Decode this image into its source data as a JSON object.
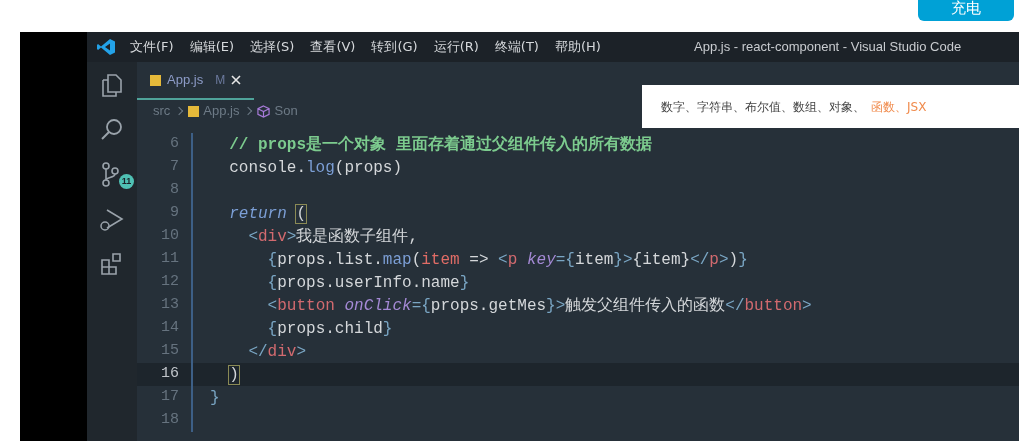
{
  "page_button": {
    "label": "充电"
  },
  "menu_bar": {
    "items": [
      "文件(F)",
      "编辑(E)",
      "选择(S)",
      "查看(V)",
      "转到(G)",
      "运行(R)",
      "终端(T)",
      "帮助(H)"
    ],
    "title": "App.js - react-component - Visual Studio Code"
  },
  "activity_bar": {
    "items": [
      {
        "kind": "files"
      },
      {
        "kind": "search"
      },
      {
        "kind": "source-control",
        "badge": "11"
      },
      {
        "kind": "debug"
      },
      {
        "kind": "extensions"
      }
    ]
  },
  "tabs": [
    {
      "label": "App.js",
      "status": "M",
      "selected": true
    }
  ],
  "breadcrumb": [
    "src",
    "App.js",
    "Son"
  ],
  "popup": {
    "text": "数字、字符串、布尔值、数组、对象、",
    "highlight": "函数、JSX"
  },
  "code": [
    {
      "number": "6",
      "current": false,
      "tokens": [
        {
          "text": "  // props是一个对象 里面存着通过父组件传入的所有数据",
          "kind": "comment"
        }
      ]
    },
    {
      "number": "7",
      "current": false,
      "tokens": [
        {
          "text": "  console.",
          "kind": "plain"
        },
        {
          "text": "log",
          "kind": "func"
        },
        {
          "text": "(props)",
          "kind": "plain"
        }
      ]
    },
    {
      "number": "8",
      "current": false
    },
    {
      "number": "9",
      "current": false,
      "tokens": [
        {
          "text": "  return",
          "kind": "keyword"
        },
        {
          "text": " (",
          "kind": "match"
        }
      ]
    },
    {
      "number": "10",
      "current": false,
      "tokens": [
        {
          "text": "    <",
          "kind": "punct"
        },
        {
          "text": "div",
          "kind": "tag"
        },
        {
          "text": ">",
          "kind": "punct"
        },
        {
          "text": "我是函数子组件,",
          "kind": "plain"
        }
      ]
    },
    {
      "number": "11",
      "current": false,
      "tokens": [
        {
          "text": "      {",
          "kind": "punct"
        },
        {
          "text": "props.list.",
          "kind": "plain"
        },
        {
          "text": "map",
          "kind": "func"
        },
        {
          "text": "(",
          "kind": "plain"
        },
        {
          "text": "item",
          "kind": "param"
        },
        {
          "text": " => ",
          "kind": "plain"
        },
        {
          "text": "<",
          "kind": "punct"
        },
        {
          "text": "p",
          "kind": "tag"
        },
        {
          "text": " key",
          "kind": "attr"
        },
        {
          "text": "={",
          "kind": "punct"
        },
        {
          "text": "item",
          "kind": "plain"
        },
        {
          "text": "}>",
          "kind": "punct"
        },
        {
          "text": "{item}",
          "kind": "plain"
        },
        {
          "text": "</",
          "kind": "punct"
        },
        {
          "text": "p",
          "kind": "tag"
        },
        {
          "text": ">",
          "kind": "punct"
        },
        {
          "text": ")",
          "kind": "plain"
        },
        {
          "text": "}",
          "kind": "punct"
        }
      ]
    },
    {
      "number": "12",
      "current": false,
      "tokens": [
        {
          "text": "      {",
          "kind": "punct"
        },
        {
          "text": "props.userInfo.name",
          "kind": "plain"
        },
        {
          "text": "}",
          "kind": "punct"
        }
      ]
    },
    {
      "number": "13",
      "current": false,
      "tokens": [
        {
          "text": "      <",
          "kind": "punct"
        },
        {
          "text": "button",
          "kind": "tag"
        },
        {
          "text": " onClick",
          "kind": "attr"
        },
        {
          "text": "={",
          "kind": "punct"
        },
        {
          "text": "props.getMes",
          "kind": "plain"
        },
        {
          "text": "}>",
          "kind": "punct"
        },
        {
          "text": "触发父组件传入的函数",
          "kind": "plain"
        },
        {
          "text": "</",
          "kind": "punct"
        },
        {
          "text": "button",
          "kind": "tag"
        },
        {
          "text": ">",
          "kind": "punct"
        }
      ]
    },
    {
      "number": "14",
      "current": false,
      "tokens": [
        {
          "text": "      {",
          "kind": "punct"
        },
        {
          "text": "props.child",
          "kind": "plain"
        },
        {
          "text": "}",
          "kind": "punct"
        }
      ]
    },
    {
      "number": "15",
      "current": false,
      "tokens": [
        {
          "text": "    </",
          "kind": "punct"
        },
        {
          "text": "div",
          "kind": "tag"
        },
        {
          "text": ">",
          "kind": "punct"
        }
      ]
    },
    {
      "number": "16",
      "current": true,
      "tokens": [
        {
          "text": "  )",
          "kind": "match"
        }
      ]
    },
    {
      "number": "17",
      "current": false,
      "tokens": [
        {
          "text": "}",
          "kind": "punct"
        }
      ]
    },
    {
      "number": "18",
      "current": false
    }
  ]
}
